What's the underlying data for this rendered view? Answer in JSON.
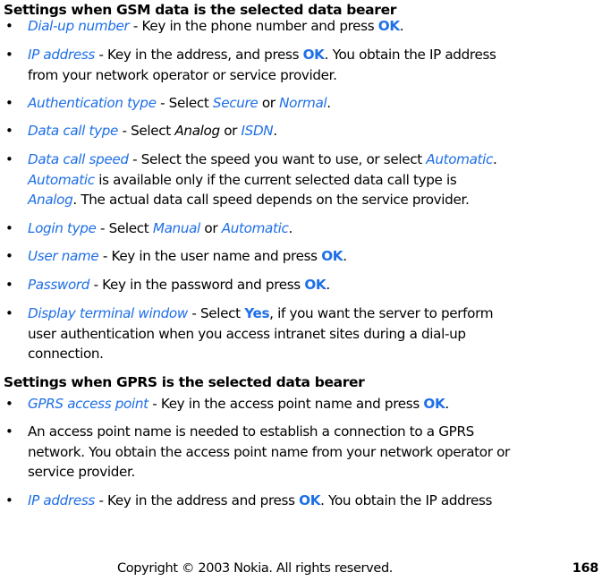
{
  "sections": [
    {
      "heading": "Settings when GSM data is the selected data bearer",
      "items": [
        {
          "term": "Dial-up number",
          "rest": " - Key in the phone number and press ",
          "kw": "OK",
          "end": "."
        },
        {
          "term": "IP address",
          "rest": " - Key in the address, and press ",
          "kw": "OK",
          "end": ". You obtain the IP address",
          "line2": "from your network operator or service provider."
        },
        {
          "term": "Authentication type",
          "rest": " - Select ",
          "opt1": "Secure",
          "or": " or ",
          "opt2": "Normal",
          "end": "."
        },
        {
          "term": "Data call type",
          "rest": " - Select ",
          "opt1": "Analog",
          "or": " or ",
          "opt2": "ISDN",
          "end": "."
        },
        {
          "term": "Data call speed",
          "rest": " - Select the speed you want to use, or select ",
          "opt1": "Automatic",
          "end": ".",
          "line2_opt": "Automatic",
          "line2": " is available only if the current selected data call type is",
          "line3_opt": "Analog",
          "line3": ". The actual data call speed depends on the service provider."
        },
        {
          "term": "Login type",
          "rest": " - Select ",
          "opt1": "Manual",
          "or": " or ",
          "opt2": "Automatic",
          "end": "."
        },
        {
          "term": "User name",
          "rest": " - Key in the user name and press ",
          "kw": "OK",
          "end": "."
        },
        {
          "term": "Password",
          "rest": " - Key in the password and press ",
          "kw": "OK",
          "end": "."
        },
        {
          "term": "Display terminal window",
          "rest": " - Select ",
          "kw": "Yes",
          "end": ", if you want the server to perform",
          "line2": "user authentication when you access intranet sites during a dial-up",
          "line3": "connection."
        }
      ]
    },
    {
      "heading": "Settings when GPRS is the selected data bearer",
      "items": [
        {
          "term": "GPRS access point",
          "rest": " - Key in the access point name and press ",
          "kw": "OK",
          "end": "."
        },
        {
          "line1": "An access point name is needed to establish a connection to a GPRS",
          "line2": "network. You obtain the access point name from your network operator or",
          "line3": "service provider."
        },
        {
          "term": "IP address",
          "rest": " - Key in the address and press ",
          "kw": "OK",
          "end": ". You obtain the IP address"
        }
      ]
    }
  ],
  "bullet": "•",
  "footer": {
    "copyright": "Copyright © 2003 Nokia. All rights reserved.",
    "page_number": "168"
  }
}
